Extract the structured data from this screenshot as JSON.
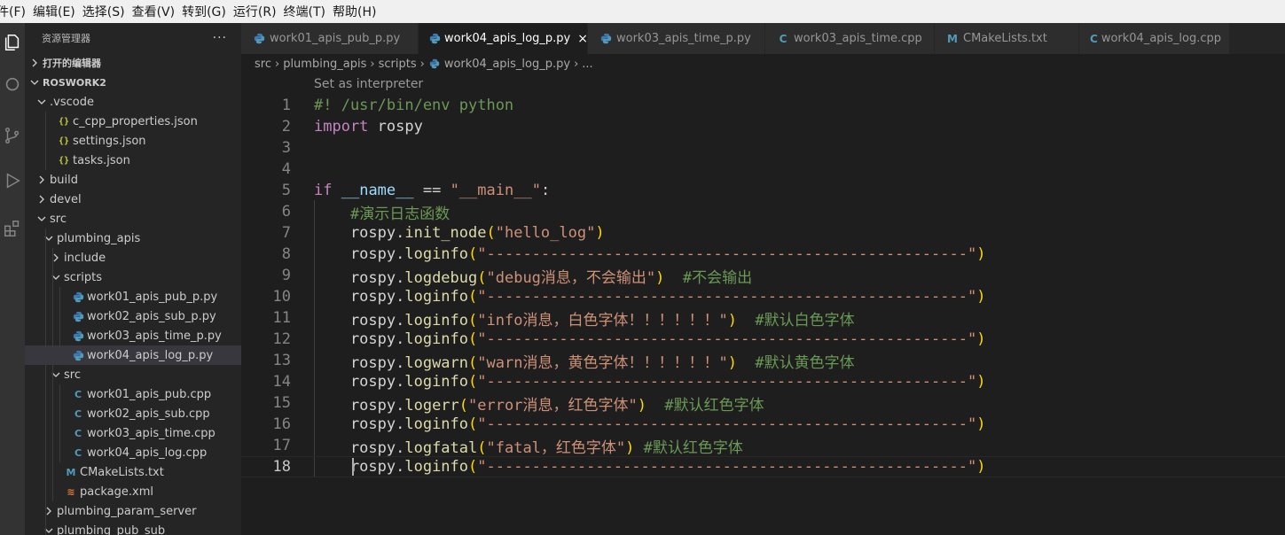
{
  "menubar": [
    "件(F)",
    "编辑(E)",
    "选择(S)",
    "查看(V)",
    "转到(G)",
    "运行(R)",
    "终端(T)",
    "帮助(H)"
  ],
  "sidebar": {
    "title": "资源管理器",
    "more": "···",
    "open_editors": "打开的编辑器",
    "workspace": "ROSWORK2",
    "tree": [
      {
        "label": ".vscode",
        "type": "folder-open",
        "level": 1
      },
      {
        "label": "c_cpp_properties.json",
        "type": "json",
        "level": 2
      },
      {
        "label": "settings.json",
        "type": "json",
        "level": 2
      },
      {
        "label": "tasks.json",
        "type": "json",
        "level": 2
      },
      {
        "label": "build",
        "type": "folder",
        "level": 1
      },
      {
        "label": "devel",
        "type": "folder",
        "level": 1
      },
      {
        "label": "src",
        "type": "folder-open",
        "level": 1
      },
      {
        "label": "plumbing_apis",
        "type": "folder-open",
        "level": 2
      },
      {
        "label": "include",
        "type": "folder",
        "level": 3
      },
      {
        "label": "scripts",
        "type": "folder-open",
        "level": 3
      },
      {
        "label": "work01_apis_pub_p.py",
        "type": "py",
        "level": 4
      },
      {
        "label": "work02_apis_sub_p.py",
        "type": "py",
        "level": 4
      },
      {
        "label": "work03_apis_time_p.py",
        "type": "py",
        "level": 4
      },
      {
        "label": "work04_apis_log_p.py",
        "type": "py",
        "level": 4,
        "selected": true
      },
      {
        "label": "src",
        "type": "folder-open",
        "level": 3
      },
      {
        "label": "work01_apis_pub.cpp",
        "type": "cpp",
        "level": 4
      },
      {
        "label": "work02_apis_sub.cpp",
        "type": "cpp",
        "level": 4
      },
      {
        "label": "work03_apis_time.cpp",
        "type": "cpp",
        "level": 4
      },
      {
        "label": "work04_apis_log.cpp",
        "type": "cpp",
        "level": 4
      },
      {
        "label": "CMakeLists.txt",
        "type": "cmake",
        "level": 3
      },
      {
        "label": "package.xml",
        "type": "xml",
        "level": 3
      },
      {
        "label": "plumbing_param_server",
        "type": "folder",
        "level": 2
      },
      {
        "label": "plumbing_pub_sub",
        "type": "folder-open",
        "level": 2
      }
    ]
  },
  "tabs": [
    {
      "label": "work01_apis_pub_p.py",
      "type": "py"
    },
    {
      "label": "work04_apis_log_p.py",
      "type": "py",
      "active": true,
      "close": "×"
    },
    {
      "label": "work03_apis_time_p.py",
      "type": "py"
    },
    {
      "label": "work03_apis_time.cpp",
      "type": "cpp"
    },
    {
      "label": "CMakeLists.txt",
      "type": "cmake"
    },
    {
      "label": "work04_apis_log.cpp",
      "type": "cpp"
    }
  ],
  "breadcrumb": [
    "src",
    "plumbing_apis",
    "scripts",
    "work04_apis_log_p.py",
    "..."
  ],
  "editor": {
    "codelens": "Set as interpreter",
    "current_line": 18,
    "lines": [
      {
        "n": "1",
        "tokens": [
          [
            "com",
            "#! /usr/bin/env python"
          ]
        ]
      },
      {
        "n": "2",
        "tokens": [
          [
            "imp",
            "import"
          ],
          [
            "txt",
            " rospy"
          ]
        ]
      },
      {
        "n": "3",
        "tokens": []
      },
      {
        "n": "4",
        "tokens": []
      },
      {
        "n": "5",
        "tokens": [
          [
            "imp",
            "if"
          ],
          [
            "txt",
            " "
          ],
          [
            "var",
            "__name__"
          ],
          [
            "txt",
            " == "
          ],
          [
            "str",
            "\"__main__\""
          ],
          [
            "txt",
            ":"
          ]
        ]
      },
      {
        "n": "6",
        "tokens": [
          [
            "txt",
            "    "
          ],
          [
            "com",
            "#演示日志函数"
          ]
        ]
      },
      {
        "n": "7",
        "tokens": [
          [
            "txt",
            "    rospy."
          ],
          [
            "fn",
            "init_node"
          ],
          [
            "paren",
            "("
          ],
          [
            "str",
            "\"hello_log\""
          ],
          [
            "paren",
            ")"
          ]
        ]
      },
      {
        "n": "8",
        "tokens": [
          [
            "txt",
            "    rospy."
          ],
          [
            "fn",
            "loginfo"
          ],
          [
            "paren",
            "("
          ],
          [
            "str",
            "\"-----------------------------------------------------\""
          ],
          [
            "paren",
            ")"
          ]
        ]
      },
      {
        "n": "9",
        "tokens": [
          [
            "txt",
            "    rospy."
          ],
          [
            "fn",
            "logdebug"
          ],
          [
            "paren",
            "("
          ],
          [
            "str",
            "\"debug消息，不会输出\""
          ],
          [
            "paren",
            ")"
          ],
          [
            "txt",
            "  "
          ],
          [
            "com",
            "#不会输出"
          ]
        ]
      },
      {
        "n": "10",
        "tokens": [
          [
            "txt",
            "    rospy."
          ],
          [
            "fn",
            "loginfo"
          ],
          [
            "paren",
            "("
          ],
          [
            "str",
            "\"-----------------------------------------------------\""
          ],
          [
            "paren",
            ")"
          ]
        ]
      },
      {
        "n": "11",
        "tokens": [
          [
            "txt",
            "    rospy."
          ],
          [
            "fn",
            "loginfo"
          ],
          [
            "paren",
            "("
          ],
          [
            "str",
            "\"info消息，白色字体！！！！！！\""
          ],
          [
            "paren",
            ")"
          ],
          [
            "txt",
            "  "
          ],
          [
            "com",
            "#默认白色字体"
          ]
        ]
      },
      {
        "n": "12",
        "tokens": [
          [
            "txt",
            "    rospy."
          ],
          [
            "fn",
            "loginfo"
          ],
          [
            "paren",
            "("
          ],
          [
            "str",
            "\"-----------------------------------------------------\""
          ],
          [
            "paren",
            ")"
          ]
        ]
      },
      {
        "n": "13",
        "tokens": [
          [
            "txt",
            "    rospy."
          ],
          [
            "fn",
            "logwarn"
          ],
          [
            "paren",
            "("
          ],
          [
            "str",
            "\"warn消息，黄色字体！！！！！！\""
          ],
          [
            "paren",
            ")"
          ],
          [
            "txt",
            "  "
          ],
          [
            "com",
            "#默认黄色字体"
          ]
        ]
      },
      {
        "n": "14",
        "tokens": [
          [
            "txt",
            "    rospy."
          ],
          [
            "fn",
            "loginfo"
          ],
          [
            "paren",
            "("
          ],
          [
            "str",
            "\"-----------------------------------------------------\""
          ],
          [
            "paren",
            ")"
          ]
        ]
      },
      {
        "n": "15",
        "tokens": [
          [
            "txt",
            "    rospy."
          ],
          [
            "fn",
            "logerr"
          ],
          [
            "paren",
            "("
          ],
          [
            "str",
            "\"error消息，红色字体\""
          ],
          [
            "paren",
            ")"
          ],
          [
            "txt",
            "  "
          ],
          [
            "com",
            "#默认红色字体"
          ]
        ]
      },
      {
        "n": "16",
        "tokens": [
          [
            "txt",
            "    rospy."
          ],
          [
            "fn",
            "loginfo"
          ],
          [
            "paren",
            "("
          ],
          [
            "str",
            "\"-----------------------------------------------------\""
          ],
          [
            "paren",
            ")"
          ]
        ]
      },
      {
        "n": "17",
        "tokens": [
          [
            "txt",
            "    rospy."
          ],
          [
            "fn",
            "logfatal"
          ],
          [
            "paren",
            "("
          ],
          [
            "str",
            "\"fatal，红色字体\""
          ],
          [
            "paren",
            ")"
          ],
          [
            "txt",
            " "
          ],
          [
            "com",
            "#默认红色字体"
          ]
        ]
      },
      {
        "n": "18",
        "tokens": [
          [
            "txt",
            "    rospy."
          ],
          [
            "fn",
            "loginfo"
          ],
          [
            "paren",
            "("
          ],
          [
            "str",
            "\"-----------------------------------------------------\""
          ],
          [
            "paren",
            ")"
          ]
        ]
      }
    ]
  },
  "colors": {
    "editor_bg": "#1e1e1e",
    "sidebar_bg": "#252526",
    "activity_bg": "#333333",
    "selected_row": "#37373d"
  }
}
